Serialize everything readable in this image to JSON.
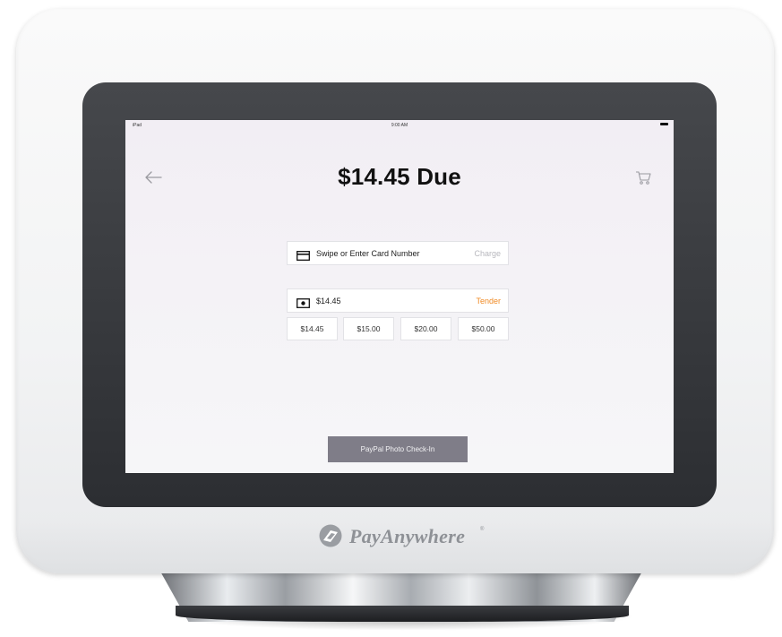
{
  "status_bar": {
    "device": "iPad",
    "time": "9:00 AM"
  },
  "header": {
    "title": "$14.45 Due"
  },
  "card_field": {
    "label": "Swipe or Enter Card Number",
    "action": "Charge",
    "icon": "credit-card-icon"
  },
  "cash_field": {
    "value": "$14.45",
    "action": "Tender",
    "icon": "cash-icon"
  },
  "quick_amounts": [
    "$14.45",
    "$15.00",
    "$20.00",
    "$50.00"
  ],
  "photo_checkin": {
    "label": "PayPal Photo Check-In"
  },
  "brand": {
    "name": "PayAnywhere",
    "mark": "®"
  },
  "colors": {
    "tender_accent": "#f08a24",
    "charge_muted": "#b8b8be",
    "button_bg": "#7f7d88"
  }
}
